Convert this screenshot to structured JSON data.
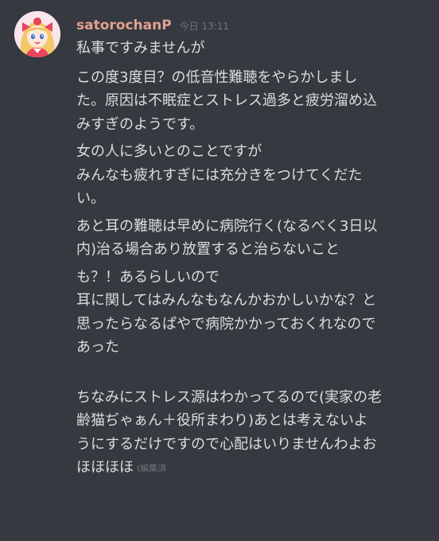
{
  "message": {
    "username": "satorochanP",
    "timestamp": "今日 13:11",
    "edited_label": "(編集済",
    "lines": [
      "私事ですみませんが",
      "この度3度目？の低音性難聴をやらかしまし",
      "た。原因は不眠症とストレス過多と疲労溜め込",
      "みすぎのようです。",
      "女の人に多いとのことですが",
      "みんなも疲れすぎには充分きをつけてくだた",
      "い。",
      "あと耳の難聴は早めに病院行く(なるべく3日以",
      "内)治る場合あり放置すると治らないこと",
      "も？！あるらしいので",
      "耳に関してはみんなもなんかおかしいかな？と",
      "思ったらなるぱやで病院かかっておくれなので",
      "あった",
      "ちなみにストレス源はわかってるので(実家の老",
      "齢猫ぢゃぁん＋役所まわり)あとは考えないよ",
      "うにするだけですので心配はいりませんわよお",
      "ほほほほ"
    ]
  },
  "colors": {
    "background": "#36393f",
    "username": "#e0a08e",
    "text": "#dcddde",
    "muted": "#72767d"
  },
  "icons": {
    "avatar": "anime-girl-avatar"
  }
}
